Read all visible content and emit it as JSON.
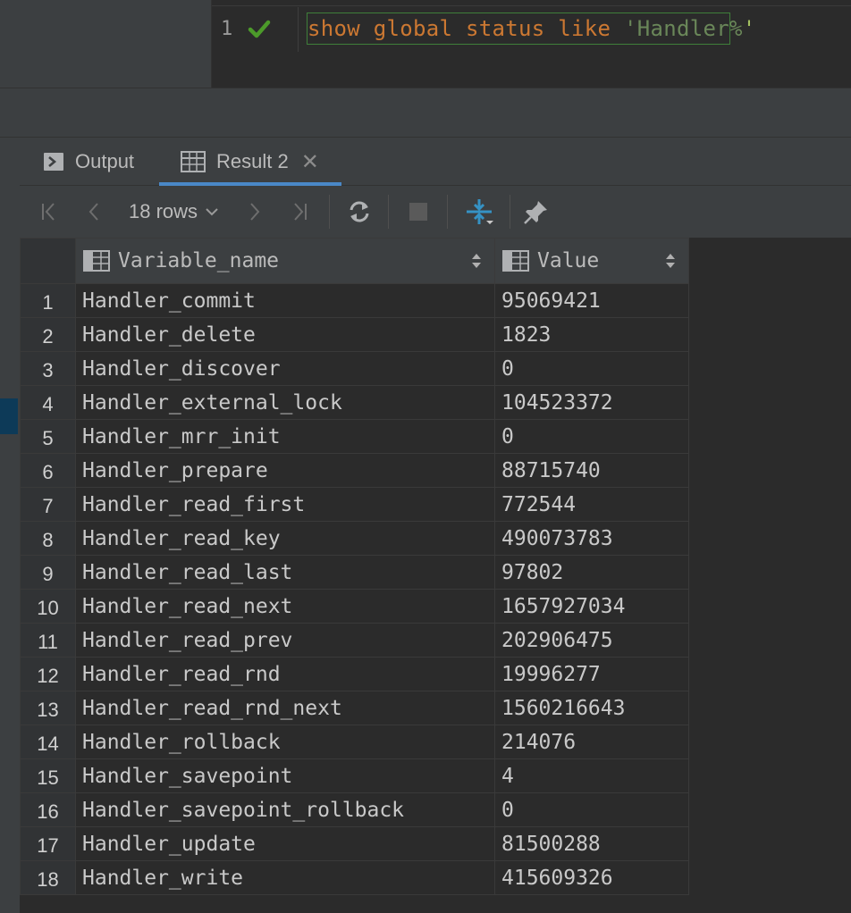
{
  "editor": {
    "line_number": "1",
    "query": {
      "keywords": "show global status like ",
      "string_open": "'",
      "string_body": "Handler%",
      "string_close": "'"
    }
  },
  "tabs": [
    {
      "label": "Output",
      "icon": "console-icon"
    },
    {
      "label": "Result 2",
      "icon": "table-icon",
      "active": true
    }
  ],
  "toolbar": {
    "rows_label": "18 rows",
    "icons": [
      "first-page-icon",
      "previous-page-icon",
      "next-page-icon",
      "last-page-icon",
      "refresh-icon",
      "stop-icon",
      "compare-icon",
      "pin-icon"
    ]
  },
  "grid": {
    "columns": [
      "Variable_name",
      "Value"
    ],
    "rows": [
      {
        "n": "1",
        "name": "Handler_commit",
        "value": "95069421"
      },
      {
        "n": "2",
        "name": "Handler_delete",
        "value": "1823"
      },
      {
        "n": "3",
        "name": "Handler_discover",
        "value": "0"
      },
      {
        "n": "4",
        "name": "Handler_external_lock",
        "value": "104523372"
      },
      {
        "n": "5",
        "name": "Handler_mrr_init",
        "value": "0"
      },
      {
        "n": "6",
        "name": "Handler_prepare",
        "value": "88715740"
      },
      {
        "n": "7",
        "name": "Handler_read_first",
        "value": "772544"
      },
      {
        "n": "8",
        "name": "Handler_read_key",
        "value": "490073783"
      },
      {
        "n": "9",
        "name": "Handler_read_last",
        "value": "97802"
      },
      {
        "n": "10",
        "name": "Handler_read_next",
        "value": "1657927034"
      },
      {
        "n": "11",
        "name": "Handler_read_prev",
        "value": "202906475"
      },
      {
        "n": "12",
        "name": "Handler_read_rnd",
        "value": "19996277"
      },
      {
        "n": "13",
        "name": "Handler_read_rnd_next",
        "value": "1560216643"
      },
      {
        "n": "14",
        "name": "Handler_rollback",
        "value": "214076"
      },
      {
        "n": "15",
        "name": "Handler_savepoint",
        "value": "4"
      },
      {
        "n": "16",
        "name": "Handler_savepoint_rollback",
        "value": "0"
      },
      {
        "n": "17",
        "name": "Handler_update",
        "value": "81500288"
      },
      {
        "n": "18",
        "name": "Handler_write",
        "value": "415609326"
      }
    ]
  },
  "colors": {
    "keyword": "#cc7832",
    "string": "#6a8759",
    "success_check": "#4c9a2a",
    "active_tab": "#4a88c7",
    "compare_icon": "#3592c4"
  }
}
